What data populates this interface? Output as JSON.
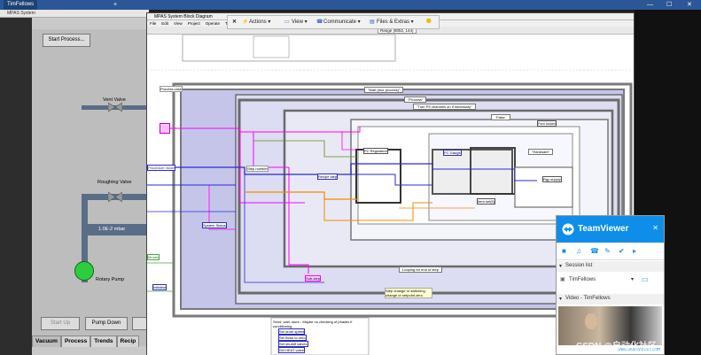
{
  "teamviewer_bar": {
    "tab_title": "TimFellows",
    "add_tab": "+",
    "minimize": "—",
    "maximize": "☐",
    "close": "✕"
  },
  "front_panel": {
    "window_title": "MPAS System",
    "start_button": "Start Process...",
    "vent_valve_label": "Vent Valve",
    "roughing_valve_label": "Roughing Valve",
    "pressure_display": "1.0E-2 mbar",
    "rotary_pump_label": "Rotary Pump",
    "start_up_button": "Start Up",
    "pump_down_button": "Pump Down",
    "tabs": [
      "Vacuum",
      "Process",
      "Trends",
      "Recip"
    ],
    "active_tab": "Vacuum"
  },
  "block_diagram": {
    "window_title": "MPAS System Block Diagram",
    "menu": [
      "File",
      "Edit",
      "View",
      "Project",
      "Operate",
      "Tools",
      "Windo"
    ],
    "labels": {
      "process_case": "Process case",
      "wait_true": "\"Wait (true process)\"",
      "process_str": "\"Process\"",
      "turn_on": "\"Turn PS channels on if necessary\"",
      "false_label": "False",
      "procedure_model": "Procedure model",
      "step_number": "Step number",
      "recipe_step": "Recipe step",
      "pc_regulation": "PC Regulation",
      "pc_gauge": "PC Gauge",
      "fsm_locked": "Fsm locked",
      "hardware": "\"Hardware\"",
      "rgy_supply": "Rgy supply",
      "item_set": "Item set(5)",
      "system_status": "System Status",
      "mmain": "Mmain",
      "initialise": "Initialise",
      "looping": "Looping for end of step",
      "sub_step": "Sub-step",
      "step_change": "Step change or switching change or setpoint zero",
      "note": "Send, wait, store - Maybe no checking of phases if conditioning",
      "set_drum": "Set drum speed",
      "set_flows": "Set flows to zero",
      "set_shutoff": "Set shutoff valves",
      "set_heat": "Set HEAT valve",
      "range": "Range (8052, 144)"
    }
  },
  "tv_toolbar": {
    "close": "✕",
    "actions": "Actions",
    "view": "View",
    "communicate": "Communicate",
    "files": "Files & Extras"
  },
  "tv_panel": {
    "brand": "TeamViewer",
    "session_list": "Session list",
    "session_name": "TimFellows",
    "video_label": "Video - TimFellows",
    "url": "www.teamviewer.com"
  },
  "watermark": {
    "line1": "公众号 · 合",
    "line2": "CSDN @自动化社区"
  },
  "colors": {
    "tv_blue": "#0e8ee9",
    "pump_green": "#2ecc40",
    "wire_pink": "#ff00ff",
    "wire_blue": "#2a2ad0",
    "wire_orange": "#f28c00",
    "frame_gray": "#7a7a7a"
  }
}
